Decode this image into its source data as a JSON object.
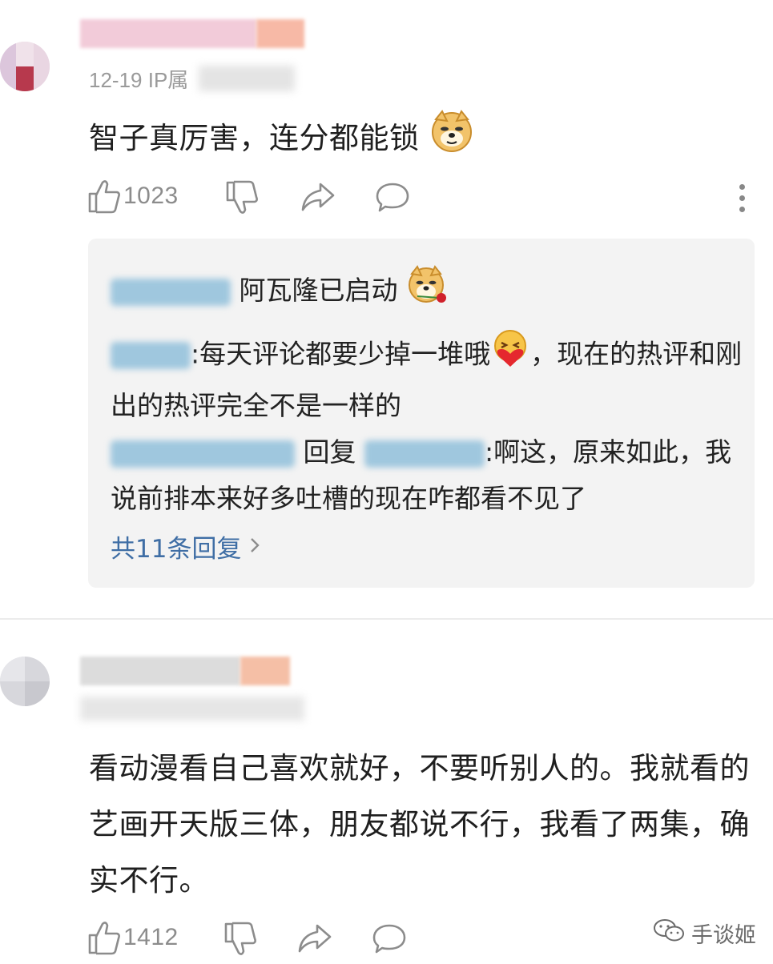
{
  "comment1": {
    "date_ip": "12-19 IP属",
    "text": "智子真厉害，连分都能锁",
    "likes": "1023",
    "replies": [
      {
        "text": "阿瓦隆已启动"
      },
      {
        "text": ":每天评论都要少掉一堆哦",
        "text_after": "，现在的热评和刚出的热评完全不是一样的"
      },
      {
        "reply_word": "回复",
        "text": ":啊这，原来如此，我说前排本来好多吐槽的现在咋都看不见了"
      }
    ],
    "more_replies_label": "共11条回复"
  },
  "comment2": {
    "text": "看动漫看自己喜欢就好，不要听别人的。我就看的艺画开天版三体，朋友都说不行，我看了两集，确实不行。",
    "likes": "1412"
  },
  "watermark": {
    "label": "手谈姬",
    "icon": "wechat-icon"
  },
  "colors": {
    "link": "#3f6ea5",
    "reply_bg": "#f3f3f3",
    "meta": "#9a9a9a"
  }
}
